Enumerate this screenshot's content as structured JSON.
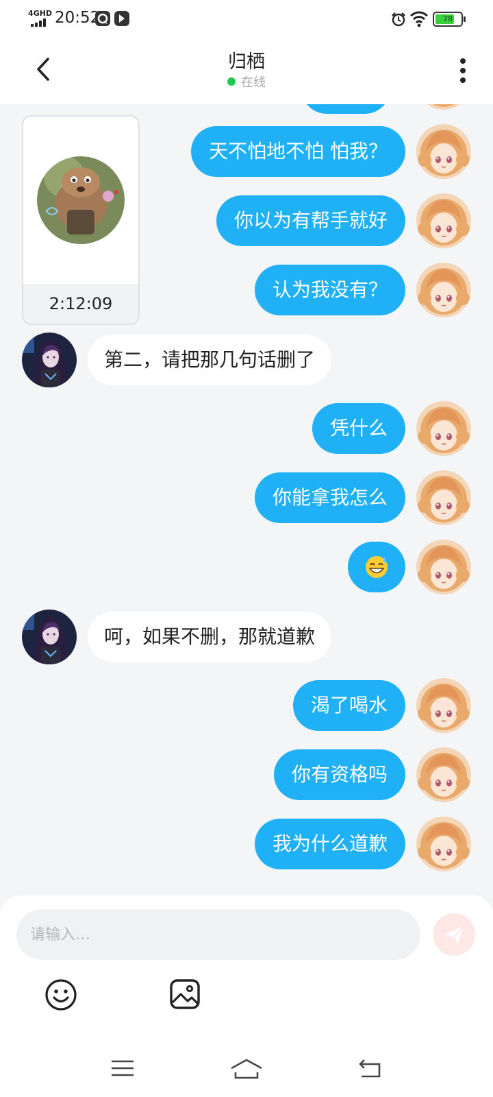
{
  "status_bar": {
    "network": "4GHD",
    "time": "20:52",
    "battery_level": "78",
    "battery_fraction": 0.78,
    "icons": [
      "signal-icon",
      "app-notification-icon",
      "app-notification-icon",
      "alarm-icon",
      "wifi-icon",
      "battery-icon"
    ]
  },
  "header": {
    "title": "归栖",
    "status": "在线",
    "status_color": "#1ec94c",
    "back_icon": "chevron-left-icon",
    "more_icon": "more-vertical-icon"
  },
  "chat": {
    "video_message": {
      "duration": "2:12:09",
      "sender": "peer"
    },
    "messages": [
      {
        "sender": "me",
        "text": "天不怕地不怕 怕我？"
      },
      {
        "sender": "me",
        "text": "你以为有帮手就好"
      },
      {
        "sender": "me",
        "text": "认为我没有？"
      },
      {
        "sender": "peer",
        "text": "第二，请把那几句话删了"
      },
      {
        "sender": "me",
        "text": "凭什么"
      },
      {
        "sender": "me",
        "text": "你能拿我怎么"
      },
      {
        "sender": "me",
        "text": "😅"
      },
      {
        "sender": "peer",
        "text": "呵，如果不删，那就道歉"
      },
      {
        "sender": "me",
        "text": "渴了喝水"
      },
      {
        "sender": "me",
        "text": "你有资格吗"
      },
      {
        "sender": "me",
        "text": "我为什么道歉"
      }
    ],
    "bubble_colors": {
      "me": "#1fb0f5",
      "peer": "#ffffff"
    }
  },
  "composer": {
    "placeholder": "请输入…",
    "value": "",
    "send_icon": "send-icon",
    "emoji_icon": "emoji-icon",
    "image_icon": "image-icon"
  },
  "nav_bar": {
    "icons": [
      "menu-icon",
      "home-icon",
      "back-icon"
    ]
  }
}
